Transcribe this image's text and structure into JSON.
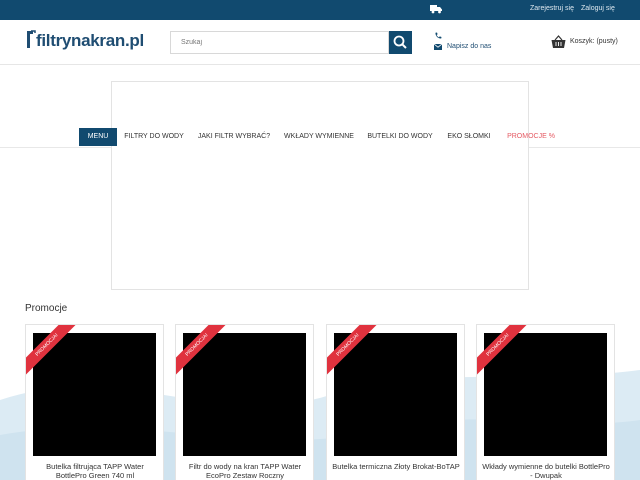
{
  "topbar": {
    "truck_icon": "truck-icon",
    "register_link": "Zarejestruj się",
    "login_link": "Zaloguj się"
  },
  "header": {
    "logo_text": "filtrynakran.pl",
    "search_placeholder": "Szukaj",
    "search_icon": "search-icon",
    "phone_icon": "phone-icon",
    "mail_icon": "envelope-icon",
    "contact_link": "Napisz do nas",
    "cart_icon": "basket-icon",
    "cart_label": "Koszyk: (pusty)"
  },
  "menu": {
    "items": [
      {
        "label": "MENU"
      },
      {
        "label": "FILTRY DO WODY"
      },
      {
        "label": "JAKI FILTR WYBRAĆ?"
      },
      {
        "label": "WKŁADY WYMIENNE"
      },
      {
        "label": "BUTELKI DO WODY"
      },
      {
        "label": "EKO SŁOMKI"
      },
      {
        "label": "PROMOCJE %"
      }
    ]
  },
  "promotions": {
    "title": "Promocje",
    "products": [
      {
        "badge": "PROMOCJA!",
        "name": "Butelka filtrująca TAPP Water BottlePro Green 740 ml"
      },
      {
        "badge": "PROMOCJA!",
        "name": "Filtr do wody na kran TAPP Water EcoPro Zestaw Roczny"
      },
      {
        "badge": "PROMOCJA!",
        "name": "Butelka termiczna Złoty Brokat-BoTAP"
      },
      {
        "badge": "PROMOCJA!",
        "name": "Wkłady wymienne do butelki BottlePro - Dwupak"
      }
    ]
  },
  "colors": {
    "brand_navy": "#114a6f",
    "promo_red": "#e0323e",
    "wave_blue": "#dcebf4"
  }
}
